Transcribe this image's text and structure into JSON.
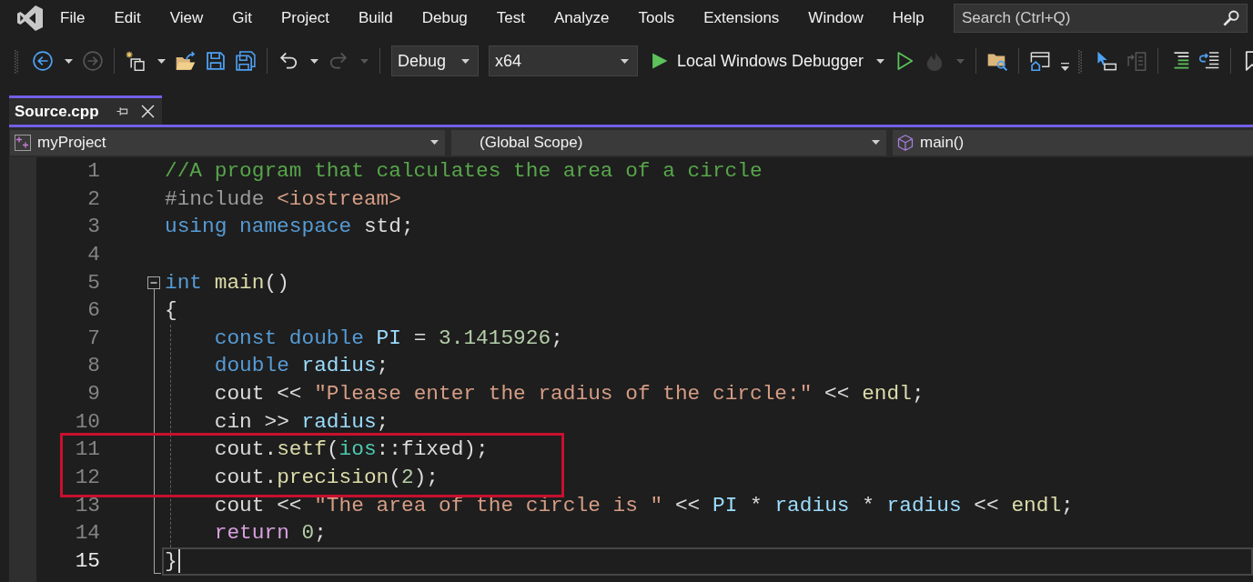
{
  "menu_bar": {
    "items": [
      "File",
      "Edit",
      "View",
      "Git",
      "Project",
      "Build",
      "Debug",
      "Test",
      "Analyze",
      "Tools",
      "Extensions",
      "Window",
      "Help"
    ],
    "search": {
      "placeholder": "Search (Ctrl+Q)"
    }
  },
  "toolbars": [
    {
      "overflow": true,
      "groups": [
        {
          "items": [
            {
              "kind": "back",
              "disabled": false,
              "dropdown": true
            },
            {
              "kind": "forward",
              "disabled": true
            }
          ]
        },
        {
          "items": [
            {
              "kind": "new",
              "disabled": false,
              "dropdown": true
            },
            {
              "kind": "open",
              "disabled": false
            },
            {
              "kind": "save",
              "disabled": false
            },
            {
              "kind": "save_all",
              "disabled": false
            }
          ]
        },
        {
          "items": [
            {
              "kind": "undo",
              "disabled": false,
              "dropdown": true
            },
            {
              "kind": "redo",
              "disabled": true,
              "dropdown": true
            }
          ]
        },
        {
          "items": [
            {
              "kind": "select",
              "disabled": false,
              "value": "Debug"
            },
            {
              "kind": "select",
              "disabled": false,
              "value": "x64"
            },
            {
              "kind": "start",
              "disabled": false,
              "dropdown": true,
              "label": "Local Windows Debugger"
            },
            {
              "kind": "run",
              "disabled": false
            },
            {
              "kind": "hot_reload",
              "disabled": true,
              "dropdown": true
            }
          ]
        },
        {
          "items": [
            {
              "kind": "find",
              "disabled": false
            }
          ]
        },
        {
          "items": [
            {
              "kind": "window",
              "disabled": false
            }
          ]
        }
      ]
    },
    {
      "groups": [
        {
          "items": [
            {
              "kind": "pointer",
              "disabled": false
            },
            {
              "kind": "format",
              "disabled": true
            }
          ]
        },
        {
          "items": [
            {
              "kind": "comment",
              "disabled": false
            },
            {
              "kind": "uncomment",
              "disabled": false
            }
          ]
        },
        {
          "items": [
            {
              "kind": "bookmark",
              "disabled": false
            }
          ]
        }
      ]
    }
  ],
  "tabs": [
    {
      "label": "Source.cpp",
      "selected": true
    }
  ],
  "navigation_bar": {
    "project": "myProject",
    "scope": "(Global Scope)",
    "member": "main()"
  },
  "editor": {
    "lines": [
      {
        "number": "1",
        "current": false,
        "tokens": [
          {
            "kind": "comment",
            "text": "//A program that calculates the area of a circle"
          }
        ]
      },
      {
        "number": "2",
        "current": false,
        "tokens": [
          {
            "kind": "preprocessor",
            "text": "#include "
          },
          {
            "kind": "string",
            "text": "<iostream>"
          }
        ]
      },
      {
        "number": "3",
        "current": false,
        "tokens": [
          {
            "kind": "keyword",
            "text": "using namespace"
          },
          {
            "kind": "plain",
            "text": " std;"
          }
        ]
      },
      {
        "number": "4",
        "current": false
      },
      {
        "number": "5",
        "current": false,
        "fold_start": true,
        "expanded": true,
        "tokens": [
          {
            "kind": "keyword",
            "text": "int "
          },
          {
            "kind": "function",
            "text": "main"
          },
          {
            "kind": "plain",
            "text": "()"
          }
        ]
      },
      {
        "number": "6",
        "current": false,
        "tokens": [
          {
            "kind": "plain",
            "text": "{"
          }
        ]
      },
      {
        "number": "7",
        "current": false,
        "tokens": [
          {
            "kind": "keyword",
            "text": "    const double "
          },
          {
            "kind": "variable",
            "text": "PI"
          },
          {
            "kind": "plain",
            "text": " = "
          },
          {
            "kind": "number",
            "text": "3.1415926"
          },
          {
            "kind": "plain",
            "text": ";"
          }
        ]
      },
      {
        "number": "8",
        "current": false,
        "tokens": [
          {
            "kind": "keyword",
            "text": "    double "
          },
          {
            "kind": "variable",
            "text": "radius"
          },
          {
            "kind": "plain",
            "text": ";"
          }
        ]
      },
      {
        "number": "9",
        "current": false,
        "tokens": [
          {
            "kind": "plain",
            "text": "    cout << "
          },
          {
            "kind": "string",
            "text": "\"Please enter the radius of the circle:\""
          },
          {
            "kind": "plain",
            "text": " << "
          },
          {
            "kind": "function",
            "text": "endl"
          },
          {
            "kind": "plain",
            "text": ";"
          }
        ]
      },
      {
        "number": "10",
        "current": false,
        "tokens": [
          {
            "kind": "plain",
            "text": "    cin >> "
          },
          {
            "kind": "variable",
            "text": "radius"
          },
          {
            "kind": "plain",
            "text": ";"
          }
        ]
      },
      {
        "number": "11",
        "current": false,
        "boxed": true,
        "tokens": [
          {
            "kind": "plain",
            "text": "    cout."
          },
          {
            "kind": "function",
            "text": "setf"
          },
          {
            "kind": "plain",
            "text": "("
          },
          {
            "kind": "type",
            "text": "ios"
          },
          {
            "kind": "plain",
            "text": "::fixed);"
          }
        ]
      },
      {
        "number": "12",
        "current": false,
        "boxed": true,
        "tokens": [
          {
            "kind": "plain",
            "text": "    cout."
          },
          {
            "kind": "function",
            "text": "precision"
          },
          {
            "kind": "plain",
            "text": "("
          },
          {
            "kind": "number",
            "text": "2"
          },
          {
            "kind": "plain",
            "text": ");"
          }
        ]
      },
      {
        "number": "13",
        "current": false,
        "tokens": [
          {
            "kind": "plain",
            "text": "    cout << "
          },
          {
            "kind": "string",
            "text": "\"The area of the circle is \""
          },
          {
            "kind": "plain",
            "text": " << "
          },
          {
            "kind": "variable",
            "text": "PI"
          },
          {
            "kind": "plain",
            "text": " * "
          },
          {
            "kind": "variable",
            "text": "radius"
          },
          {
            "kind": "plain",
            "text": " * "
          },
          {
            "kind": "variable",
            "text": "radius"
          },
          {
            "kind": "plain",
            "text": " << "
          },
          {
            "kind": "function",
            "text": "endl"
          },
          {
            "kind": "plain",
            "text": ";"
          }
        ]
      },
      {
        "number": "14",
        "current": false,
        "tokens": [
          {
            "kind": "control",
            "text": "    return "
          },
          {
            "kind": "number",
            "text": "0"
          },
          {
            "kind": "plain",
            "text": ";"
          }
        ]
      },
      {
        "number": "15",
        "current": true,
        "fold_end": true,
        "tokens": [
          {
            "kind": "plain",
            "text": "}"
          }
        ]
      }
    ]
  }
}
